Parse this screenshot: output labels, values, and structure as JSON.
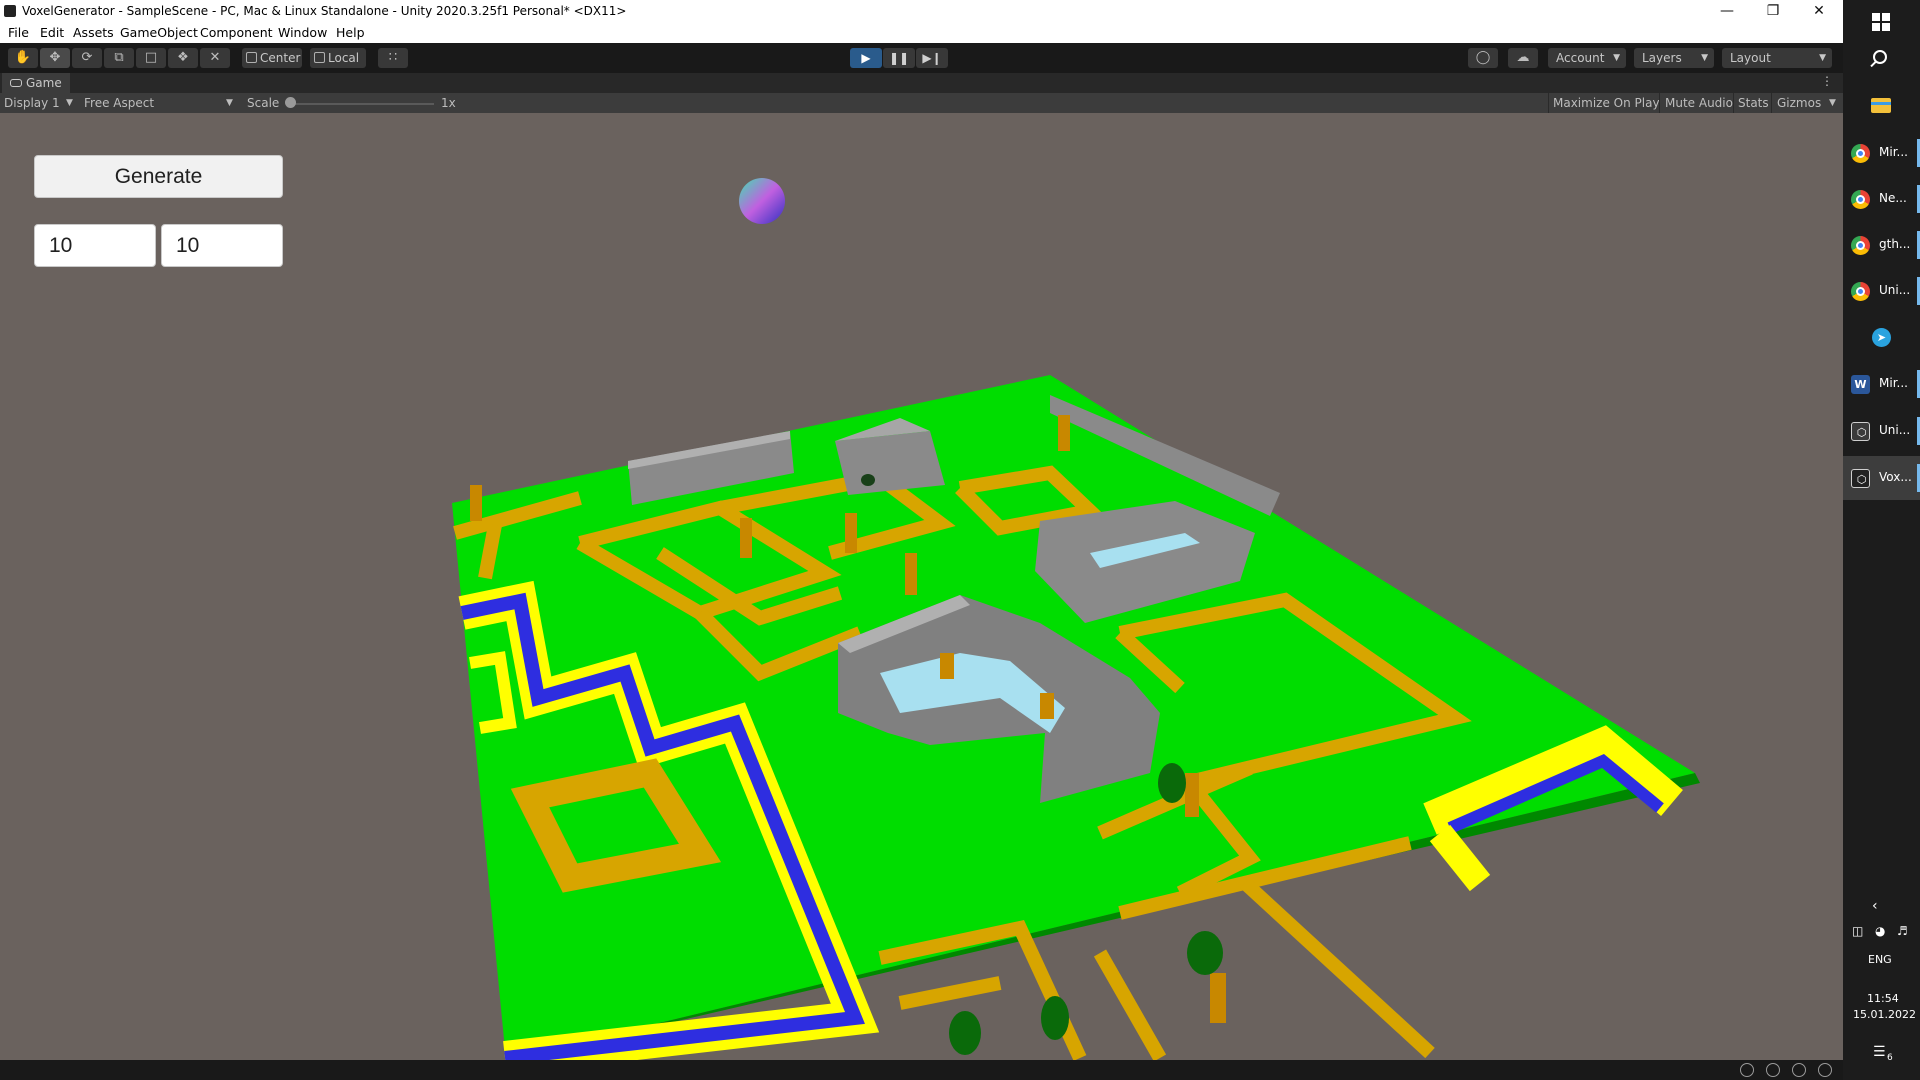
{
  "window": {
    "title": "VoxelGenerator - SampleScene - PC, Mac & Linux Standalone - Unity 2020.3.25f1 Personal* <DX11>",
    "controls": {
      "minimize": "—",
      "restore": "❐",
      "close": "✕"
    }
  },
  "menu": [
    "File",
    "Edit",
    "Assets",
    "GameObject",
    "Component",
    "Window",
    "Help"
  ],
  "toolbar": {
    "tools": [
      "hand-icon",
      "move-icon",
      "rotate-icon",
      "scale-icon",
      "rect-icon",
      "transform-icon",
      "custom-tool-icon"
    ],
    "pivot_label": "Center",
    "space_label": "Local",
    "account_label": "Account",
    "layers_label": "Layers",
    "layout_label": "Layout",
    "play_state": "playing"
  },
  "game_view": {
    "tab_label": "Game",
    "display_label": "Display 1",
    "aspect_label": "Free Aspect",
    "scale_label": "Scale",
    "scale_value": "1x",
    "maximize_label": "Maximize On Play",
    "mute_label": "Mute Audio",
    "stats_label": "Stats",
    "gizmos_label": "Gizmos"
  },
  "game_ui": {
    "generate_label": "Generate",
    "width_value": "10",
    "height_value": "10"
  },
  "colors": {
    "grass": "#00dd00",
    "path": "#d7a500",
    "water": "#2e2ee0",
    "sand": "#ffff00",
    "stone": "#8a8a8a",
    "ice": "#a8e0f0",
    "sky": "#6a625e"
  },
  "taskbar": {
    "tasks": [
      {
        "label": "Mir...",
        "icon": "chrome-icon"
      },
      {
        "label": "Ne...",
        "icon": "chrome-icon"
      },
      {
        "label": "gth...",
        "icon": "chrome-icon"
      },
      {
        "label": "Uni...",
        "icon": "chrome-icon"
      },
      {
        "label": "",
        "icon": "telegram-icon"
      },
      {
        "label": "Mir...",
        "icon": "word-icon"
      },
      {
        "label": "Uni...",
        "icon": "unity-hub-icon"
      },
      {
        "label": "Vox...",
        "icon": "unity-icon"
      }
    ],
    "language": "ENG",
    "time": "11:54",
    "date": "15.01.2022",
    "notification_count": "6"
  }
}
